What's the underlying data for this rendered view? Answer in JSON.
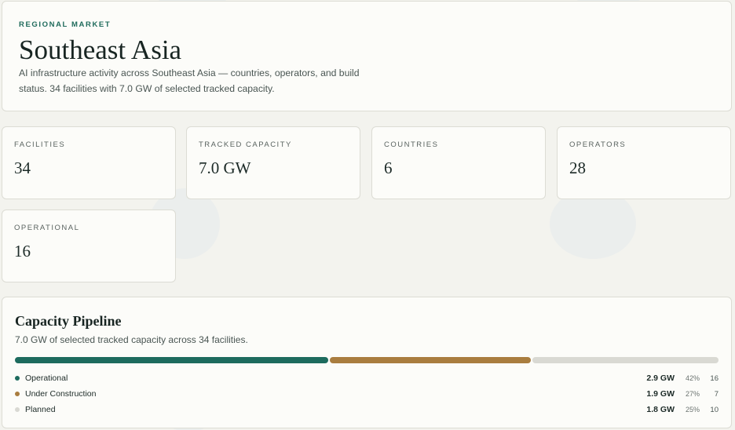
{
  "header": {
    "eyebrow": "REGIONAL MARKET",
    "title": "Southeast Asia",
    "subtitle": "AI infrastructure activity across Southeast Asia — countries, operators, and build status. 34 facilities with 7.0 GW of selected tracked capacity."
  },
  "stats": [
    {
      "label": "FACILITIES",
      "value": "34"
    },
    {
      "label": "TRACKED CAPACITY",
      "value": "7.0 GW"
    },
    {
      "label": "COUNTRIES",
      "value": "6"
    },
    {
      "label": "OPERATORS",
      "value": "28"
    },
    {
      "label": "OPERATIONAL",
      "value": "16"
    }
  ],
  "pipeline": {
    "title": "Capacity Pipeline",
    "subtitle": "7.0 GW of selected tracked capacity across 34 facilities.",
    "segments": [
      {
        "name": "Operational",
        "gw": "2.9 GW",
        "pct": "42%",
        "count": "16",
        "share": 0.42,
        "color": "#1d6b5e"
      },
      {
        "name": "Under Construction",
        "gw": "1.9 GW",
        "pct": "27%",
        "count": "7",
        "share": 0.27,
        "color": "#a97d3f"
      },
      {
        "name": "Planned",
        "gw": "1.8 GW",
        "pct": "25%",
        "count": "10",
        "share": 0.25,
        "color": "#d9d9d3"
      }
    ]
  }
}
